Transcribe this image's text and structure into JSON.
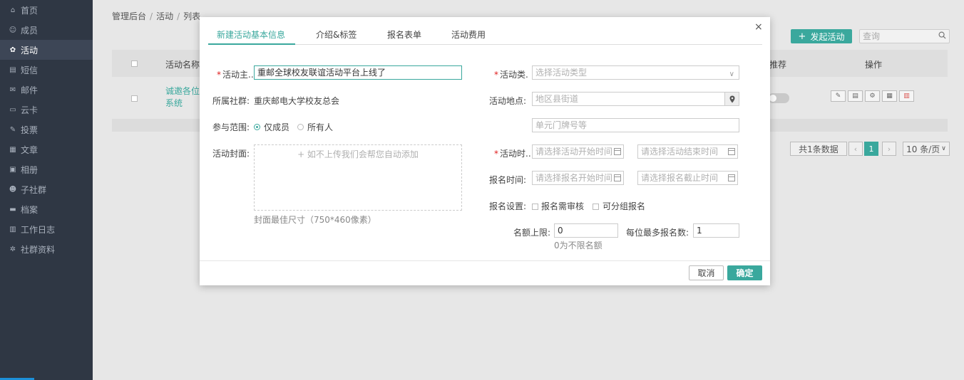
{
  "sidebar": {
    "items": [
      {
        "label": "首页",
        "icon": "home-icon",
        "glyph": "⌂"
      },
      {
        "label": "成员",
        "icon": "members-icon",
        "glyph": "☺"
      },
      {
        "label": "活动",
        "icon": "activity-icon",
        "glyph": "✿",
        "active": true
      },
      {
        "label": "短信",
        "icon": "sms-icon",
        "glyph": "▤"
      },
      {
        "label": "邮件",
        "icon": "mail-icon",
        "glyph": "✉"
      },
      {
        "label": "云卡",
        "icon": "card-icon",
        "glyph": "▭"
      },
      {
        "label": "投票",
        "icon": "vote-icon",
        "glyph": "✎"
      },
      {
        "label": "文章",
        "icon": "article-icon",
        "glyph": "▦"
      },
      {
        "label": "相册",
        "icon": "album-icon",
        "glyph": "▣"
      },
      {
        "label": "子社群",
        "icon": "subgroup-icon",
        "glyph": "☻"
      },
      {
        "label": "档案",
        "icon": "archive-icon",
        "glyph": "▬"
      },
      {
        "label": "工作日志",
        "icon": "worklog-icon",
        "glyph": "▥"
      },
      {
        "label": "社群资料",
        "icon": "settings-icon",
        "glyph": "✲"
      }
    ]
  },
  "breadcrumb": [
    "管理后台",
    "活动",
    "列表"
  ],
  "toolbar": {
    "launch_label": "发起活动",
    "search_placeholder": "查询"
  },
  "table": {
    "headers": {
      "name": "活动名称",
      "recommend": "推荐",
      "actions": "操作"
    },
    "row": {
      "name_line1": "诚邀各位",
      "name_line2": "系统"
    }
  },
  "pagination": {
    "total": "共1条数据",
    "prev": "‹",
    "current": "1",
    "next": "›",
    "page_size": "10 条/页"
  },
  "modal": {
    "tabs": [
      "新建活动基本信息",
      "介绍&标签",
      "报名表单",
      "活动费用"
    ],
    "close": "×",
    "left": {
      "subject_label": "活动主..",
      "subject_value": "重邮全球校友联谊活动平台上线了",
      "community_label": "所属社群:",
      "community_value": "重庆邮电大学校友总会",
      "scope_label": "参与范围:",
      "scope_opt1": "仅成员",
      "scope_opt2": "所有人",
      "cover_label": "活动封面:",
      "cover_upload_text": "+ 如不上传我们会帮您自动添加",
      "cover_hint": "封面最佳尺寸（750*460像素）"
    },
    "right": {
      "type_label": "活动类.",
      "type_placeholder": "选择活动类型",
      "location_label": "活动地点:",
      "location_placeholder": "地区县街道",
      "address_placeholder": "单元门牌号等",
      "time_label": "活动时..",
      "time_start_placeholder": "请选择活动开始时间",
      "time_end_placeholder": "请选择活动结束时间",
      "signup_time_label": "报名时间:",
      "signup_start_placeholder": "请选择报名开始时间",
      "signup_end_placeholder": "请选择报名截止时间",
      "signup_setting_label": "报名设置:",
      "signup_audit": "报名需审核",
      "signup_group": "可分组报名",
      "quota_label": "名额上限:",
      "quota_value": "0",
      "quota_hint": "0为不限名额",
      "per_person_label": "每位最多报名数:",
      "per_person_value": "1"
    },
    "footer": {
      "cancel": "取消",
      "ok": "确定"
    }
  },
  "colors": {
    "accent": "#3aa89d",
    "sidebar": "#2f3744",
    "required": "#e02020"
  }
}
